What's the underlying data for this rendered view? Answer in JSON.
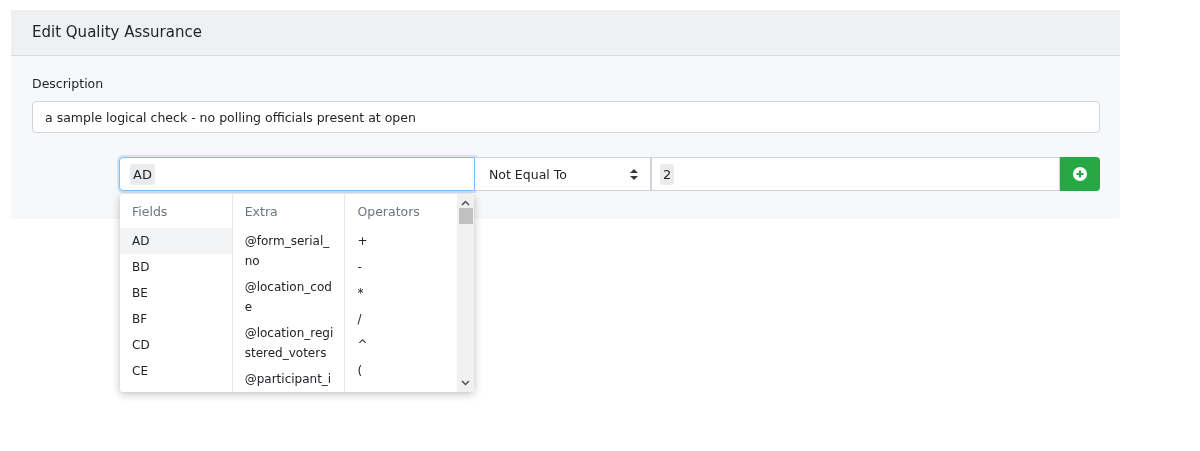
{
  "card": {
    "title": "Edit Quality Assurance"
  },
  "description": {
    "label": "Description",
    "value": "a sample logical check - no polling officials present at open"
  },
  "condition": {
    "left_token": "AD",
    "operator": "Not Equal To",
    "right_token": "2"
  },
  "dropdown": {
    "columns": [
      {
        "heading": "Fields",
        "items": [
          {
            "label": "AD",
            "selected": true
          },
          {
            "label": "BD",
            "selected": false
          },
          {
            "label": "BE",
            "selected": false
          },
          {
            "label": "BF",
            "selected": false
          },
          {
            "label": "CD",
            "selected": false
          },
          {
            "label": "CE",
            "selected": false
          }
        ]
      },
      {
        "heading": "Extra",
        "items": [
          {
            "label": "@form_serial_no",
            "selected": false
          },
          {
            "label": "@location_code",
            "selected": false
          },
          {
            "label": "@location_registered_voters",
            "selected": false
          },
          {
            "label": "@participant_i",
            "selected": false
          }
        ]
      },
      {
        "heading": "Operators",
        "items": [
          {
            "label": "+",
            "selected": false
          },
          {
            "label": "-",
            "selected": false
          },
          {
            "label": "*",
            "selected": false
          },
          {
            "label": "/",
            "selected": false
          },
          {
            "label": "^",
            "selected": false
          },
          {
            "label": "(",
            "selected": false
          }
        ]
      }
    ]
  }
}
